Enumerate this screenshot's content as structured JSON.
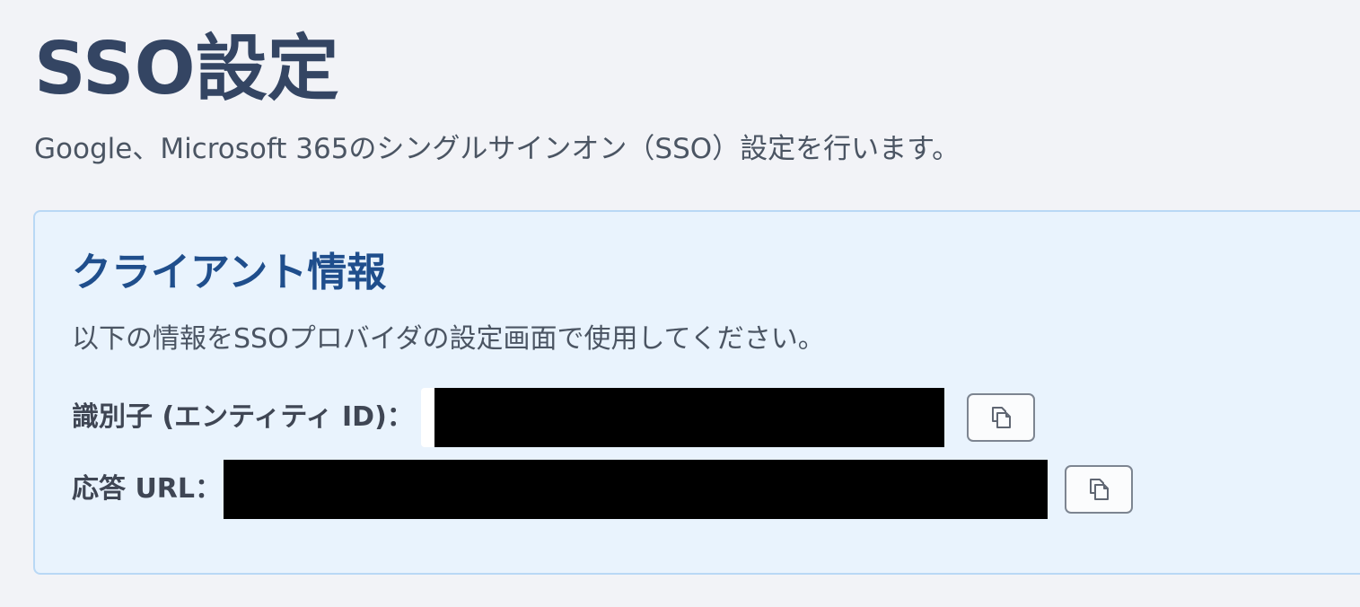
{
  "page": {
    "title": "SSO設定",
    "description": "Google、Microsoft 365のシングルサインオン（SSO）設定を行います。"
  },
  "client_info": {
    "title": "クライアント情報",
    "description": "以下の情報をSSOプロバイダの設定画面で使用してください。",
    "fields": [
      {
        "label": "識別子 (エンティティ ID)：",
        "value_state": "redacted",
        "copy_icon": "copy-icon"
      },
      {
        "label": "応答 URL：",
        "value_state": "redacted",
        "copy_icon": "copy-icon"
      }
    ]
  },
  "colors": {
    "background": "#f2f3f7",
    "card_background": "#e9f3fd",
    "card_border": "#b9d8f5",
    "title": "#344563",
    "card_title": "#1f4e8c",
    "redaction": "#000000"
  }
}
